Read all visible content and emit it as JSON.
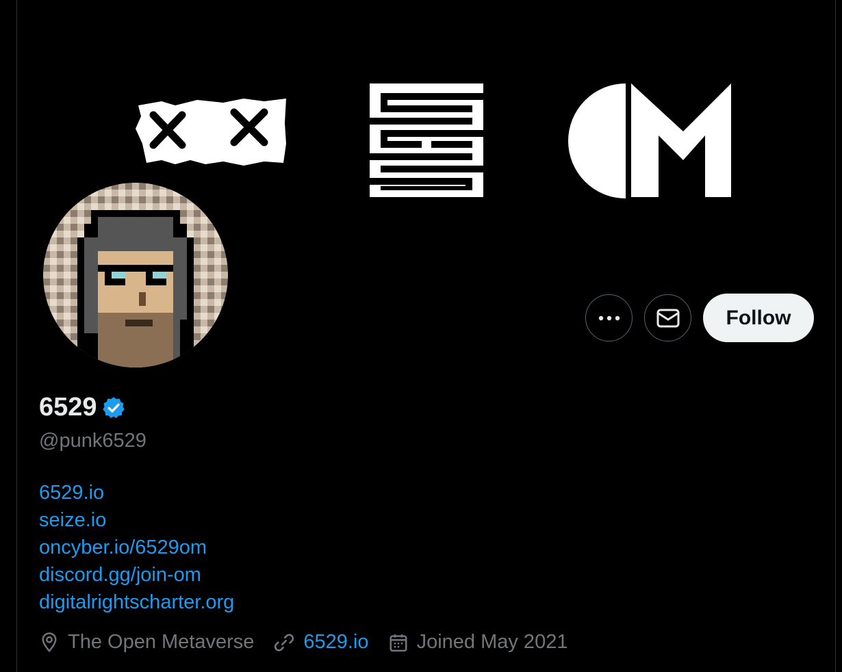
{
  "profile": {
    "name": "6529",
    "handle": "@punk6529",
    "bio_links": [
      "6529.io",
      "seize.io",
      "oncyber.io/6529om",
      "discord.gg/join-om",
      "digitalrightscharter.org"
    ],
    "location": "The Open Metaverse",
    "website": "6529.io",
    "joined": "Joined May 2021"
  },
  "actions": {
    "more_icon": "more-horizontal-icon",
    "message_icon": "envelope-icon",
    "follow_label": "Follow"
  },
  "colors": {
    "background": "#000000",
    "link": "#1d9bf0",
    "verified": "#1d9bf0",
    "muted": "#71767b",
    "follow_bg": "#eff3f4"
  }
}
